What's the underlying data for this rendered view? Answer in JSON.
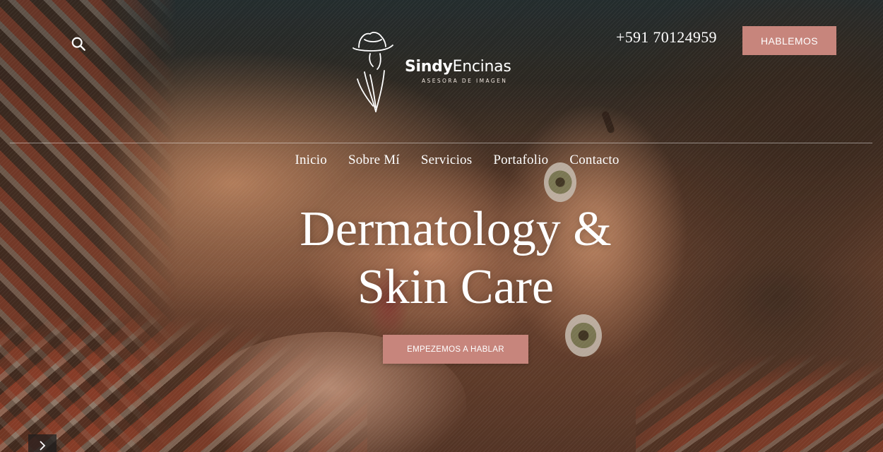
{
  "header": {
    "search_icon": "search-icon",
    "logo": {
      "name_bold": "Sindy",
      "name_light": "Encinas",
      "tagline": "ASESORA DE IMAGEN",
      "icon": "hat-silhouette-logo"
    },
    "phone": "+591 70124959",
    "cta_label": "HABLEMOS"
  },
  "nav": {
    "items": [
      {
        "label": "Inicio"
      },
      {
        "label": "Sobre Mí"
      },
      {
        "label": "Servicios"
      },
      {
        "label": "Portafolio"
      },
      {
        "label": "Contacto"
      }
    ]
  },
  "hero": {
    "headline_line1": "Dermatology &",
    "headline_line2": "Skin Care",
    "cta_label": "EMPEZEMOS A HABLAR",
    "slider_next_icon": "chevron-right-icon"
  },
  "colors": {
    "accent": "#c7857c",
    "text": "#ffffff"
  }
}
